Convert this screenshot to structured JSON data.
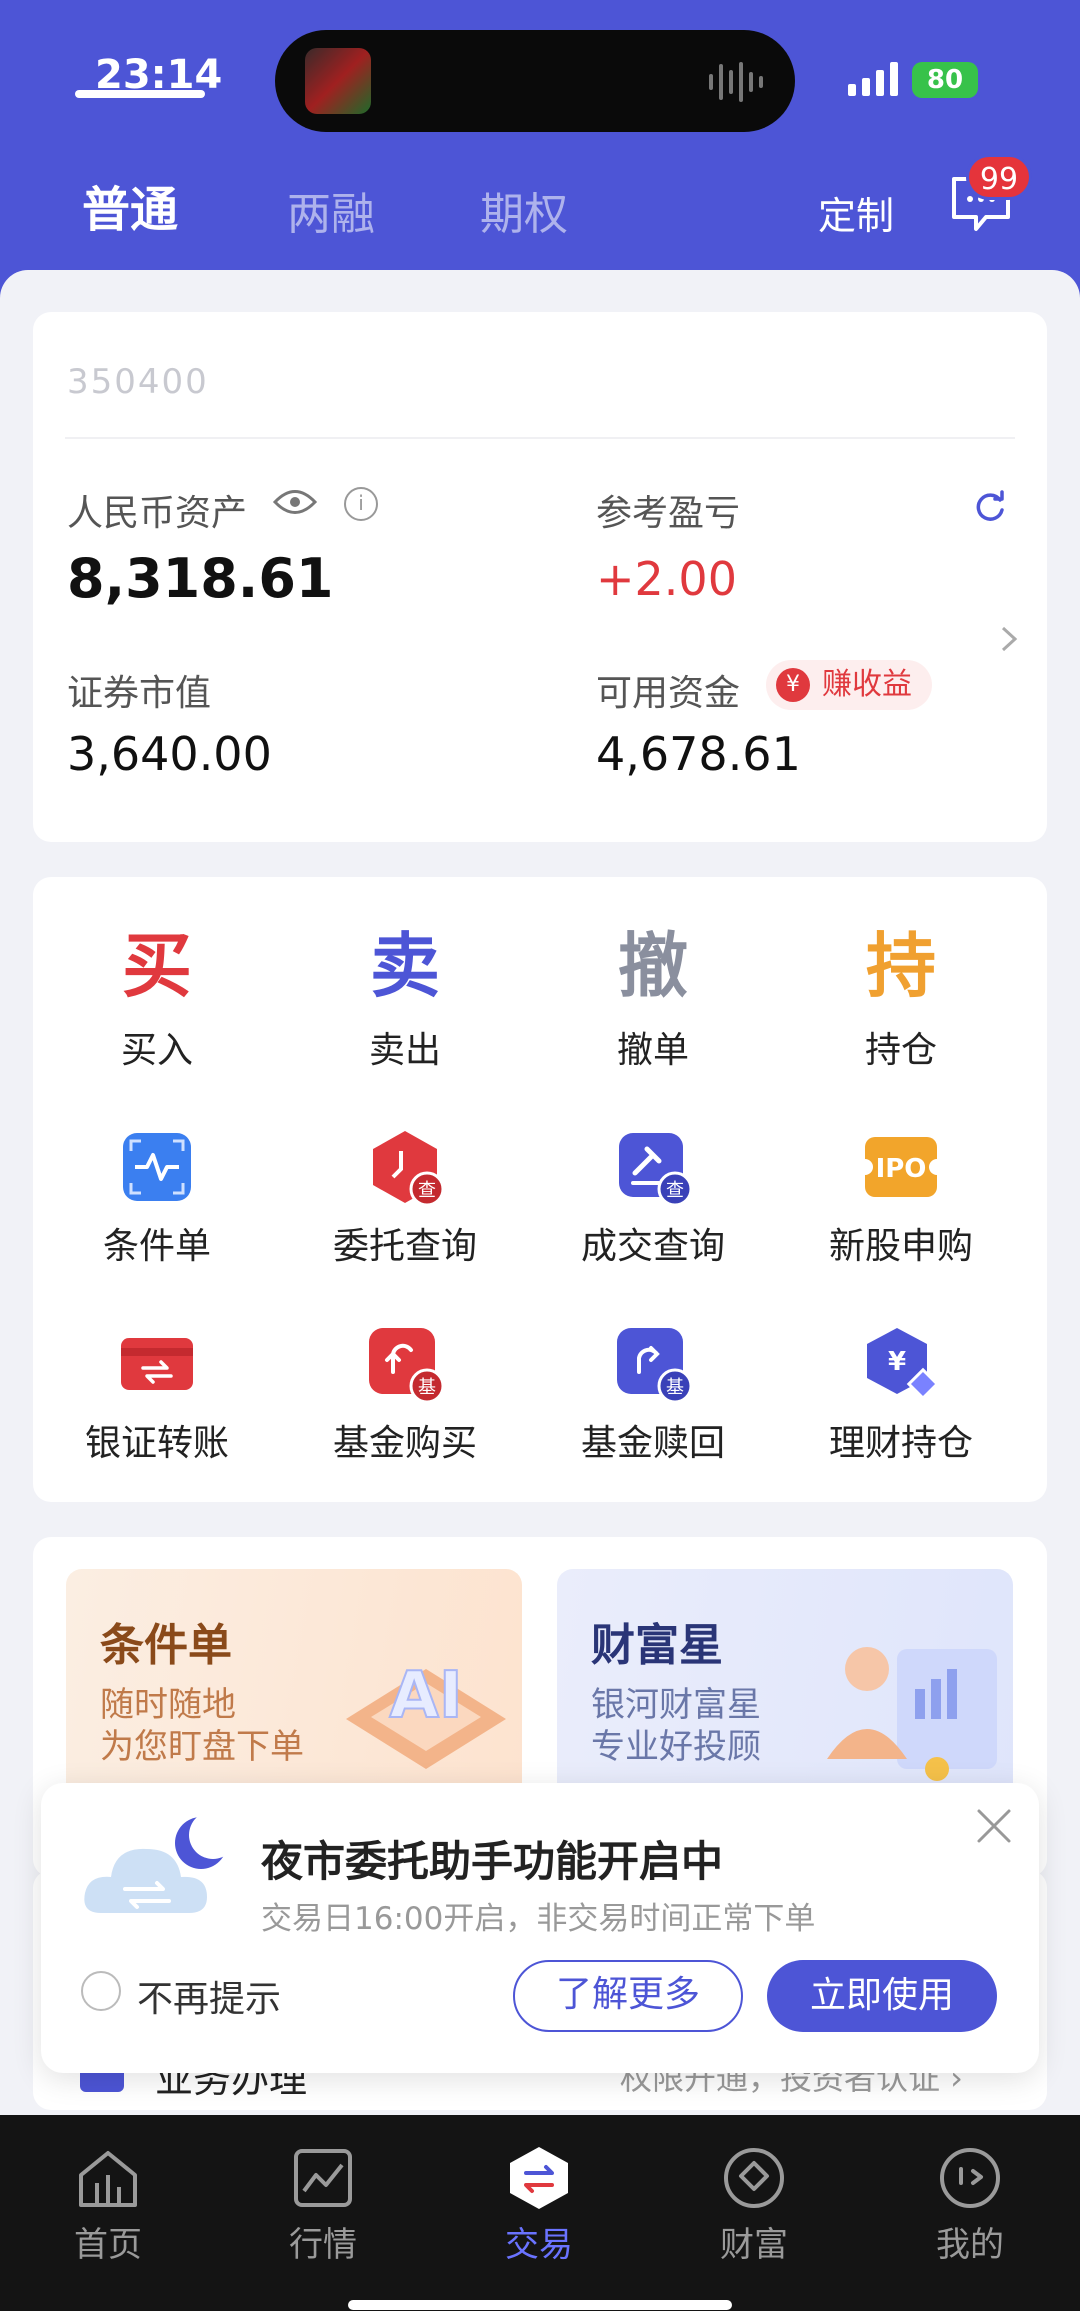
{
  "status": {
    "time": "23:14",
    "battery": "80"
  },
  "tabs": [
    {
      "label": "普通",
      "active": true
    },
    {
      "label": "两融",
      "active": false
    },
    {
      "label": "期权",
      "active": false
    }
  ],
  "header": {
    "customize": "定制",
    "msg_badge": "99"
  },
  "account": {
    "number": "350400"
  },
  "assets": {
    "rmb_label": "人民币资产",
    "rmb_value": "8,318.61",
    "pnl_label": "参考盈亏",
    "pnl_value": "+2.00",
    "market_label": "证券市值",
    "market_value": "3,640.00",
    "avail_label": "可用资金",
    "avail_value": "4,678.61",
    "earn_badge": "赚收益"
  },
  "trade_actions": [
    {
      "char": "买",
      "label": "买入",
      "color": "#e0393e"
    },
    {
      "char": "卖",
      "label": "卖出",
      "color": "#4d55d6"
    },
    {
      "char": "撤",
      "label": "撤单",
      "color": "#8a8f9e"
    },
    {
      "char": "持",
      "label": "持仓",
      "color": "#f0a030"
    }
  ],
  "functions_row2": [
    {
      "label": "条件单",
      "icon": "conditional-order-icon"
    },
    {
      "label": "委托查询",
      "icon": "order-query-icon"
    },
    {
      "label": "成交查询",
      "icon": "deal-query-icon"
    },
    {
      "label": "新股申购",
      "icon": "ipo-icon"
    }
  ],
  "functions_row3": [
    {
      "label": "银证转账",
      "icon": "bank-transfer-icon"
    },
    {
      "label": "基金购买",
      "icon": "fund-buy-icon"
    },
    {
      "label": "基金赎回",
      "icon": "fund-redeem-icon"
    },
    {
      "label": "理财持仓",
      "icon": "wealth-holding-icon"
    }
  ],
  "promos": [
    {
      "title": "条件单",
      "line1": "随时随地",
      "line2": "为您盯盘下单"
    },
    {
      "title": "财富星",
      "line1": "银河财富星",
      "line2": "专业好投顾"
    }
  ],
  "peek": {
    "title": "业务办理",
    "right": "权限开通，投资者认证 ›"
  },
  "popup": {
    "title": "夜市委托助手功能开启中",
    "subtitle": "交易日16:00开启，非交易时间正常下单",
    "no_remind": "不再提示",
    "learn_more": "了解更多",
    "use_now": "立即使用"
  },
  "bottom_nav": [
    {
      "label": "首页",
      "icon": "home-icon",
      "active": false
    },
    {
      "label": "行情",
      "icon": "market-icon",
      "active": false
    },
    {
      "label": "交易",
      "icon": "trade-icon",
      "active": true
    },
    {
      "label": "财富",
      "icon": "wealth-icon",
      "active": false
    },
    {
      "label": "我的",
      "icon": "profile-icon",
      "active": false
    }
  ]
}
